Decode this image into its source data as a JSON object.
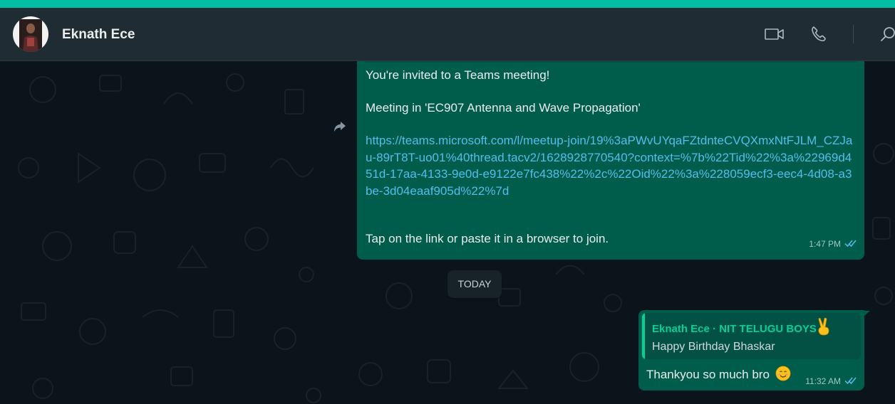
{
  "header": {
    "contact_name": "Eknath Ece"
  },
  "messages": {
    "meeting": {
      "line1": "You're invited to a Teams meeting!",
      "line2": "Meeting in 'EC907 Antenna and Wave Propagation'",
      "link": "https://teams.microsoft.com/l/meetup-join/19%3aPWvUYqaFZtdnteCVQXmxNtFJLM_CZJau-89rT8T-uo01%40thread.tacv2/1628928770540?context=%7b%22Tid%22%3a%22969d451d-17aa-4133-9e0d-e9122e7fc438%22%2c%22Oid%22%3a%228059ecf3-eec4-4d08-a3be-3d04eaaf905d%22%7d",
      "line3": "Tap on the link or paste it in a browser to join.",
      "time": "1:47 PM"
    },
    "date_divider": "TODAY",
    "reply": {
      "quoted_author": "Eknath Ece · NIT TELUGU BOYS",
      "quoted_text": "Happy Birthday Bhaskar",
      "text": "Thankyou so much bro",
      "time": "11:32 AM"
    }
  },
  "icons": [
    "video-call-icon",
    "voice-call-icon",
    "search-icon",
    "forward-icon",
    "double-check-icon",
    "victory-hand-emoji",
    "smiling-face-emoji"
  ],
  "colors": {
    "accent": "#00bfa5",
    "outgoing_bubble": "#005c4b",
    "link": "#53bdeb",
    "read_ticks": "#53bdeb",
    "quote_author": "#06cf9c"
  }
}
